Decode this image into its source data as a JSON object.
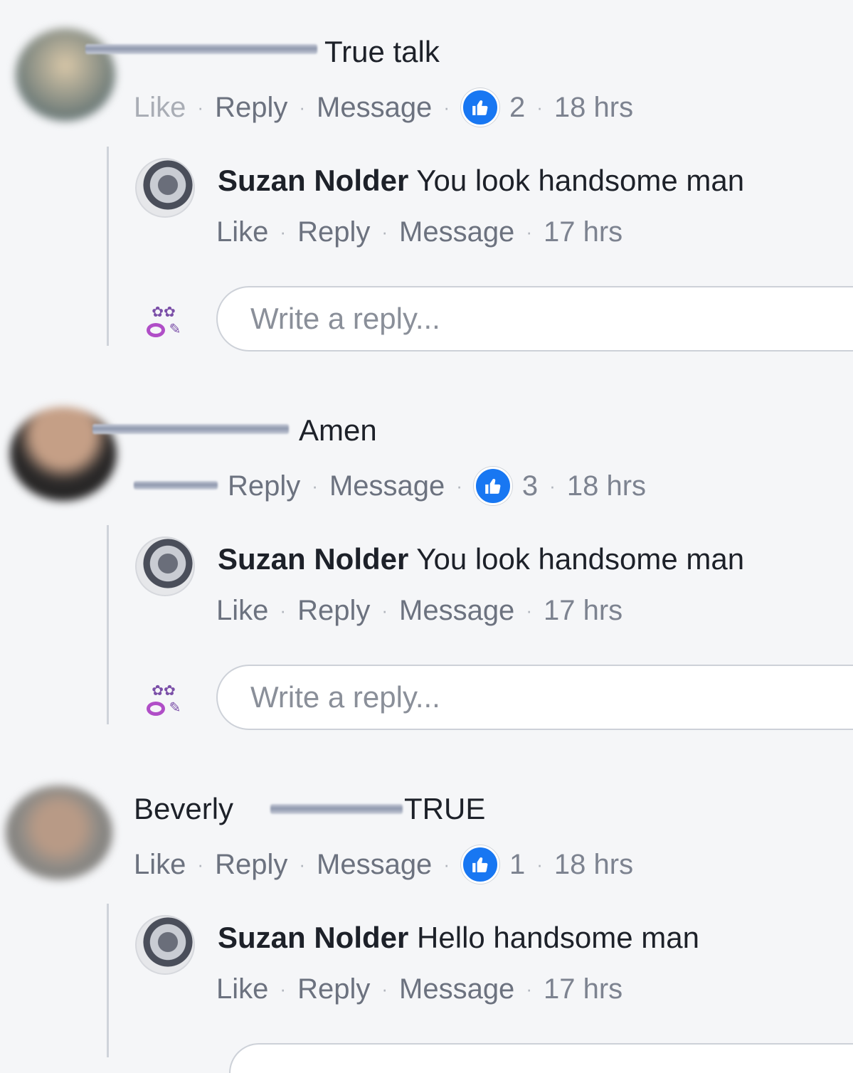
{
  "comments": [
    {
      "text": "True talk",
      "actions": {
        "like": "Like",
        "reply": "Reply",
        "message": "Message"
      },
      "reactions": "2",
      "time": "18 hrs",
      "reply": {
        "author": "Suzan Nolder",
        "text": "You look handsome man",
        "actions": {
          "like": "Like",
          "reply": "Reply",
          "message": "Message"
        },
        "time": "17 hrs"
      },
      "reply_placeholder": "Write a reply..."
    },
    {
      "text": "Amen",
      "actions": {
        "reply": "Reply",
        "message": "Message"
      },
      "reactions": "3",
      "time": "18 hrs",
      "reply": {
        "author": "Suzan Nolder",
        "text": "You look handsome man",
        "actions": {
          "like": "Like",
          "reply": "Reply",
          "message": "Message"
        },
        "time": "17 hrs"
      },
      "reply_placeholder": "Write a reply..."
    },
    {
      "author_first": "Beverly",
      "text": "TRUE",
      "actions": {
        "like": "Like",
        "reply": "Reply",
        "message": "Message"
      },
      "reactions": "1",
      "time": "18 hrs",
      "reply": {
        "author": "Suzan Nolder",
        "text": "Hello handsome man",
        "actions": {
          "like": "Like",
          "reply": "Reply",
          "message": "Message"
        },
        "time": "17 hrs"
      }
    }
  ],
  "colors": {
    "background": "#f5f6f8",
    "like_badge": "#1877f2",
    "meta_text": "#7d8390",
    "reply_avatar_accent": "#b04ec7"
  },
  "icons": {
    "like_badge": "thumbs-up-icon"
  }
}
